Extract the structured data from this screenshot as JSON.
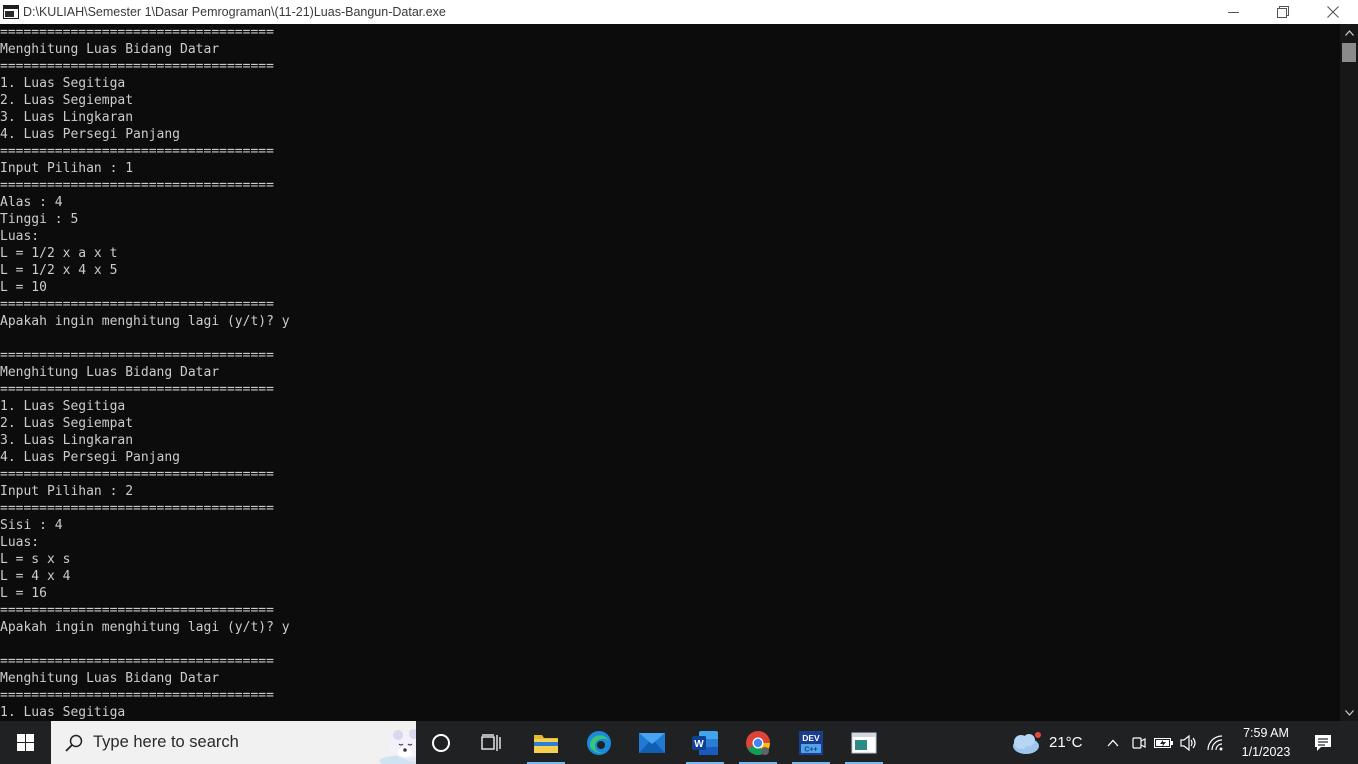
{
  "window": {
    "title": "D:\\KULIAH\\Semester 1\\Dasar Pemrograman\\(11-21)Luas-Bangun-Datar.exe",
    "controls": [
      "minimize-icon",
      "restore-icon",
      "close-icon"
    ]
  },
  "console": {
    "text_color": "#cccccc",
    "background": "#0c0c0c",
    "lines": [
      "===================================",
      "Menghitung Luas Bidang Datar",
      "===================================",
      "1. Luas Segitiga",
      "2. Luas Segiempat",
      "3. Luas Lingkaran",
      "4. Luas Persegi Panjang",
      "===================================",
      "Input Pilihan : 1",
      "===================================",
      "Alas : 4",
      "Tinggi : 5",
      "Luas:",
      "L = 1/2 x a x t",
      "L = 1/2 x 4 x 5",
      "L = 10",
      "===================================",
      "Apakah ingin menghitung lagi (y/t)? y",
      "",
      "===================================",
      "Menghitung Luas Bidang Datar",
      "===================================",
      "1. Luas Segitiga",
      "2. Luas Segiempat",
      "3. Luas Lingkaran",
      "4. Luas Persegi Panjang",
      "===================================",
      "Input Pilihan : 2",
      "===================================",
      "Sisi : 4",
      "Luas:",
      "L = s x s",
      "L = 4 x 4",
      "L = 16",
      "===================================",
      "Apakah ingin menghitung lagi (y/t)? y",
      "",
      "===================================",
      "Menghitung Luas Bidang Datar",
      "===================================",
      "1. Luas Segitiga"
    ]
  },
  "taskbar": {
    "search_placeholder": "Type here to search",
    "apps": [
      "cortana-icon",
      "task-view-icon",
      "file-explorer-icon",
      "edge-icon",
      "mail-icon",
      "word-icon",
      "chrome-icon",
      "dev-cpp-icon",
      "console-app-icon"
    ],
    "dev_label": "DEV",
    "weather_temp": "21°C",
    "time": "7:59 AM",
    "date": "1/1/2023",
    "accent": "#76b9ed"
  }
}
